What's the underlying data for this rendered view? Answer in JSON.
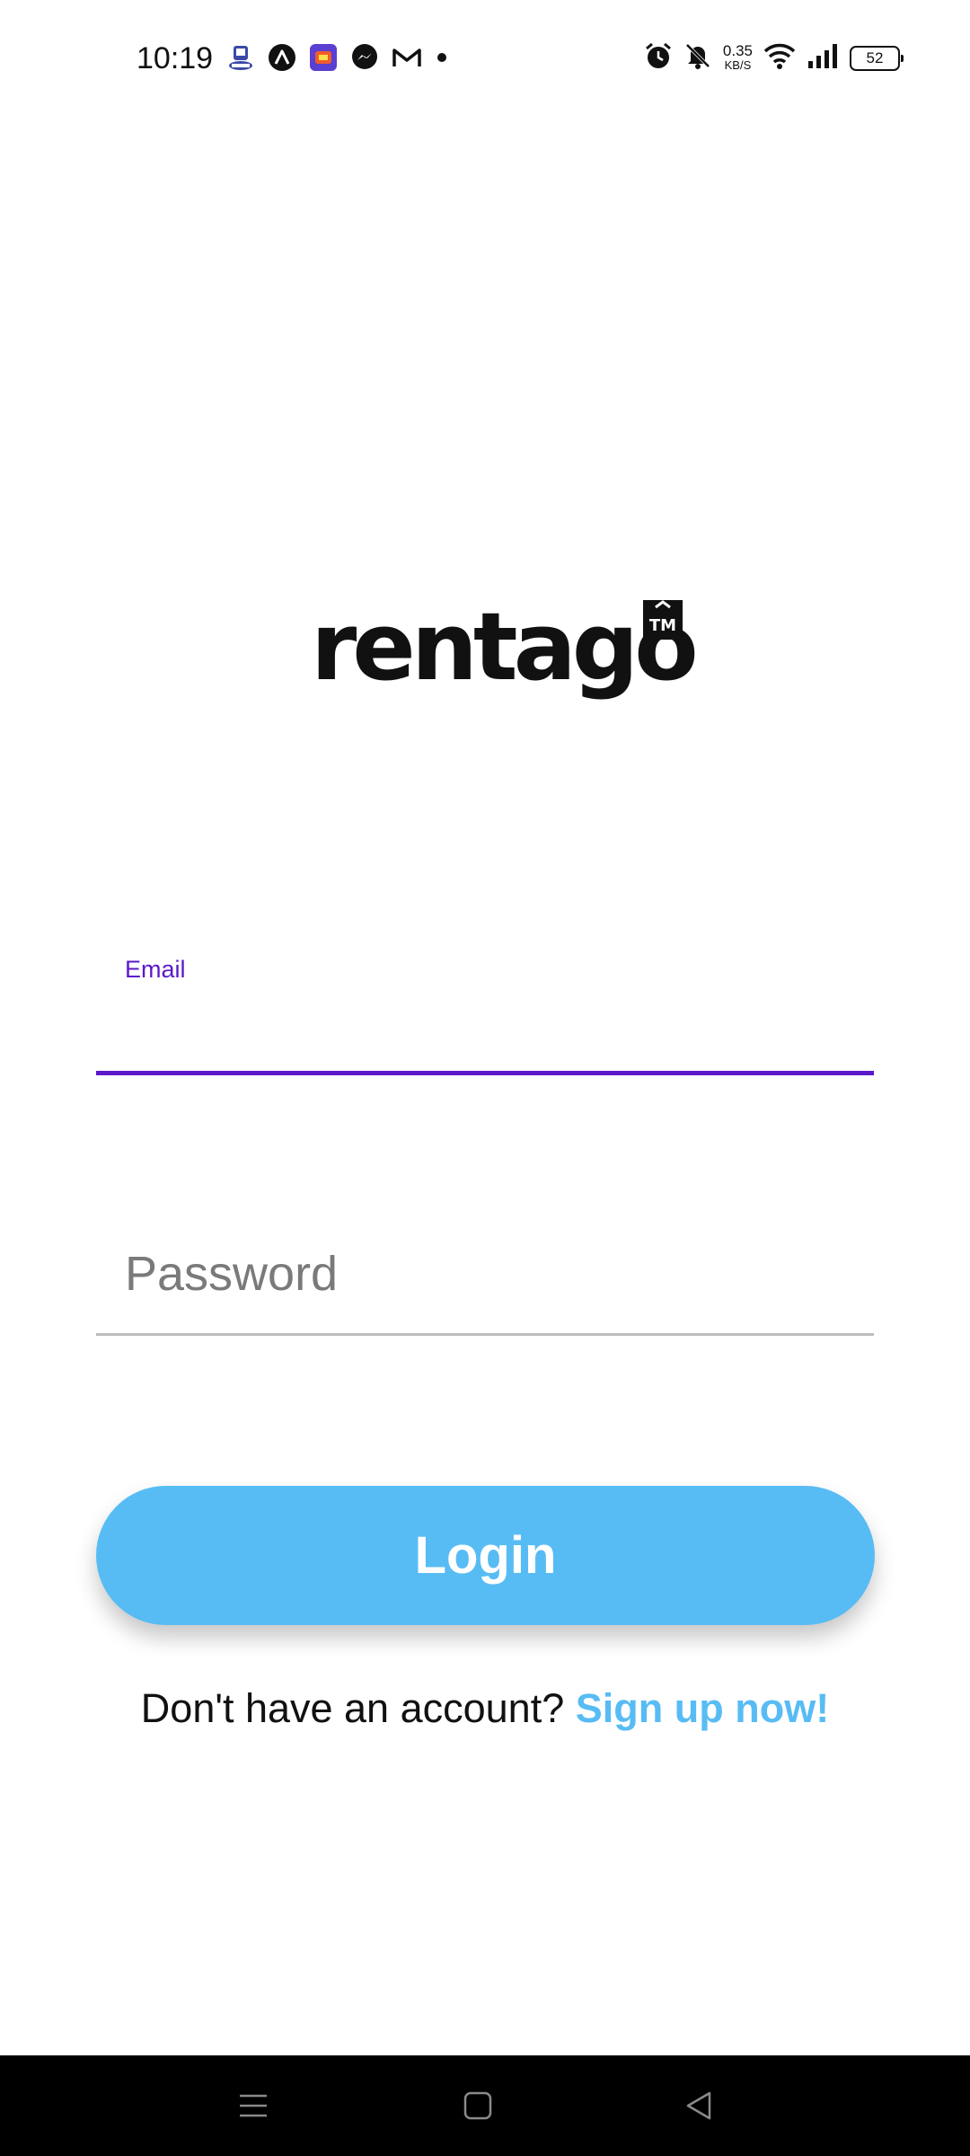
{
  "status_bar": {
    "time": "10:19",
    "net_speed_value": "0.35",
    "net_speed_unit": "KB/S",
    "battery_level": "52",
    "notification_icons": [
      "sim-icon",
      "app-a-icon",
      "app-loz-icon",
      "messenger-icon",
      "gmail-icon",
      "more-dot-icon"
    ],
    "system_icons": [
      "alarm-icon",
      "mute-icon",
      "wifi-icon",
      "signal-icon",
      "battery-icon"
    ]
  },
  "logo": {
    "text": "rentago",
    "badge": "TM"
  },
  "form": {
    "email_label": "Email",
    "email_value": "",
    "password_placeholder": "Password",
    "password_value": "",
    "login_label": "Login"
  },
  "signup": {
    "prompt": "Don't have an account?",
    "link_label": "Sign up now!"
  },
  "nav": {
    "items": [
      "menu-icon",
      "home-icon",
      "back-icon"
    ]
  },
  "colors": {
    "accent_purple": "#5b19c9",
    "primary_blue": "#58bcf4",
    "nav_background": "#000000"
  }
}
